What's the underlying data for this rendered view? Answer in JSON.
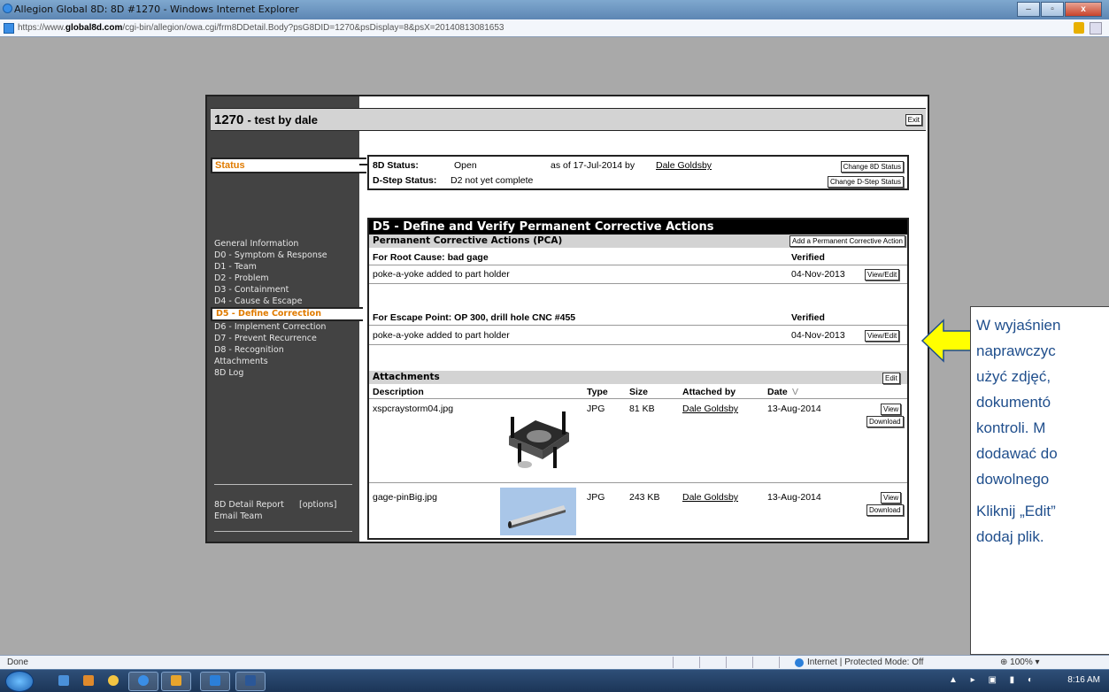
{
  "window": {
    "title": "Allegion Global 8D: 8D #1270 - Windows Internet Explorer",
    "url_prefix": "https://www.",
    "url_domain": "global8d.com",
    "url_rest": "/cgi-bin/allegion/owa.cgi/frm8DDetail.Body?psG8DID=1270&psDisplay=8&psX=20140813081653"
  },
  "header": {
    "id": "1270",
    "title": "- test by dale",
    "exit": "Exit"
  },
  "sidebar": {
    "status_tab": "Status",
    "items": [
      "General Information",
      "D0 - Symptom & Response",
      "D1 - Team",
      "D2 - Problem",
      "D3 - Containment",
      "D4 - Cause & Escape",
      "D5 - Define Correction",
      "D6 - Implement Correction",
      "D7 - Prevent Recurrence",
      "D8 - Recognition",
      "Attachments",
      "8D Log"
    ],
    "report": "8D Detail Report",
    "options": "[options]",
    "email": "Email Team"
  },
  "status": {
    "label_8d": "8D Status:",
    "value_8d": "Open",
    "as_of": "as of 17-Jul-2014 by",
    "by_user": "Dale Goldsby",
    "change_8d": "Change 8D Status",
    "label_dstep": "D-Step Status:",
    "value_dstep": "D2 not yet complete",
    "change_dstep": "Change D-Step Status"
  },
  "d5": {
    "title": "D5 - Define and Verify Permanent Corrective Actions",
    "pca_header": "Permanent Corrective Actions (PCA)",
    "add_pca": "Add a Permanent Corrective Action",
    "groups": [
      {
        "heading": "For Root Cause: bad  gage",
        "verified_label": "Verified",
        "action": "poke-a-yoke added to part holder",
        "date": "04-Nov-2013",
        "button": "View/Edit"
      },
      {
        "heading": "For Escape Point: OP 300, drill hole CNC #455",
        "verified_label": "Verified",
        "action": "poke-a-yoke added to part holder",
        "date": "04-Nov-2013",
        "button": "View/Edit"
      }
    ]
  },
  "attachments": {
    "header": "Attachments",
    "edit": "Edit",
    "columns": {
      "description": "Description",
      "type": "Type",
      "size": "Size",
      "attached_by": "Attached by",
      "date": "Date",
      "sort": "V"
    },
    "rows": [
      {
        "description": "xspcraystorm04.jpg",
        "type": "JPG",
        "size": "81 KB",
        "attached_by": "Dale Goldsby",
        "date": "13-Aug-2014",
        "view": "View",
        "download": "Download"
      },
      {
        "description": "gage-pinBig.jpg",
        "type": "JPG",
        "size": "243 KB",
        "attached_by": "Dale Goldsby",
        "date": "13-Aug-2014",
        "view": "View",
        "download": "Download"
      }
    ]
  },
  "callout": {
    "lines": [
      "W wyjaśnien",
      "naprawczyc",
      "użyć zdjęć,",
      "dokumentó",
      "kontroli.  M",
      "dodawać do",
      "dowolnego"
    ],
    "line2": [
      "Kliknij „Edit”",
      "dodaj plik."
    ],
    "color": "#1f4e8c",
    "arrow_color": "#ffff00"
  },
  "statusbar": {
    "done": "Done",
    "zone": "Internet | Protected Mode: Off",
    "zoom": "100%"
  },
  "taskbar": {
    "clock": "8:16 AM"
  }
}
